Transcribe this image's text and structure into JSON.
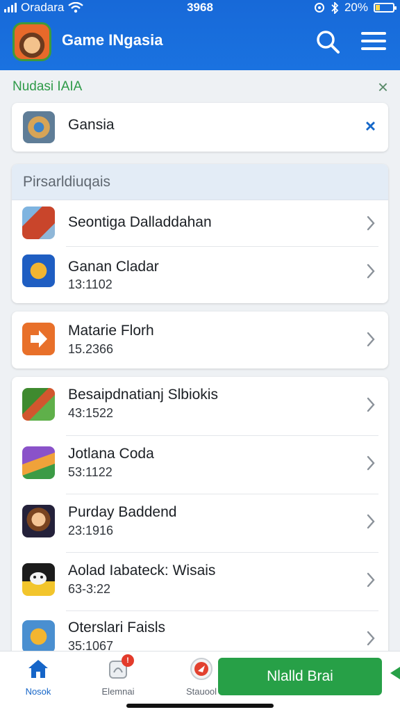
{
  "status_bar": {
    "carrier": "Oradara",
    "time": "3968",
    "battery": "20%"
  },
  "app_bar": {
    "title": "Game INgasia",
    "icons": [
      "app-logo-icon",
      "search-icon",
      "menu-icon"
    ]
  },
  "notice": {
    "text": "Nudasi IAIA",
    "close": "×"
  },
  "search_card": {
    "text": "Gansia",
    "close": "×"
  },
  "section": {
    "header": "Pirsarldiuqais"
  },
  "list_group_1": [
    {
      "title": "Seontiga Dalladdahan",
      "subtitle": "",
      "icon": "game-icon-orange-red"
    },
    {
      "title": "Ganan Cladar",
      "subtitle": "13:1102",
      "icon": "game-icon-blue-gold"
    }
  ],
  "list_group_2": [
    {
      "title": "Matarie Florh",
      "subtitle": "15.2366",
      "icon": "arrow-right-icon"
    }
  ],
  "list_group_3": [
    {
      "title": "Besaipdnatianj Slbiokis",
      "subtitle": "43:1522",
      "icon": "game-icon-green"
    },
    {
      "title": "Jotlana Coda",
      "subtitle": "53:1122",
      "icon": "game-icon-purple"
    },
    {
      "title": "Purday Baddend",
      "subtitle": "23:1916",
      "icon": "game-icon-character"
    },
    {
      "title": "Aolad Iabateck: Wisais",
      "subtitle": "63-3:22",
      "icon": "game-icon-cat"
    },
    {
      "title": "Oterslari Faisls",
      "subtitle": "35:1067",
      "icon": "game-icon-gold"
    }
  ],
  "bottom_nav": {
    "items": [
      {
        "label": "Nosok",
        "icon": "home-icon"
      },
      {
        "label": "Elemnai",
        "icon": "notification-icon",
        "badge": "!"
      },
      {
        "label": "Stauool",
        "icon": "rocket-icon"
      }
    ],
    "cta": "Nlalld Brai"
  },
  "colors": {
    "primary": "#1a6fdd",
    "accent_green": "#27a047",
    "notice_text": "#2e9a48"
  }
}
